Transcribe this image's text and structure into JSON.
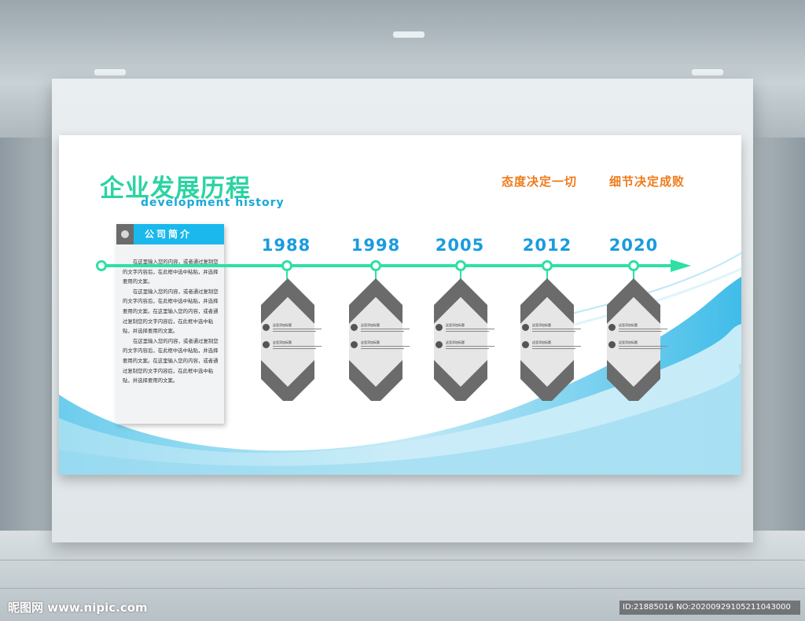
{
  "board": {
    "title_cn": "企业发展历程",
    "title_en": "development history",
    "slogans": [
      "态度决定一切",
      "细节决定成败"
    ]
  },
  "intro": {
    "heading": "公司简介",
    "paragraphs": [
      "在这里输入您的内容，或者通过复制您的文字内容后，在此框中选中粘贴，并选择要用的文案。",
      "在这里输入您的内容，或者通过复制您的文字内容后，在此框中选中粘贴，并选择要用的文案。在这里输入您的内容，或者通过复制您的文字内容后，在此框中选中粘贴，并选择要用的文案。",
      "在这里输入您的内容，或者通过复制您的文字内容后，在此框中选中粘贴，并选择要用的文案。在这里输入您的内容，或者通过复制您的文字内容后，在此框中选中粘贴，并选择要用的文案。"
    ]
  },
  "timeline": {
    "years": [
      "1988",
      "1998",
      "2005",
      "2012",
      "2020"
    ],
    "item_title": "这里添加标题"
  },
  "colors": {
    "accent_green": "#2ee0a5",
    "year_blue": "#1a9be0",
    "tab_blue": "#1ab8ec",
    "slogan_orange": "#f07a1a",
    "chevron_gray": "#6b6b6b"
  },
  "footer": {
    "watermark_left": "昵图网 www.nipic.com",
    "watermark_right": "ID:21885016 NO:20200929105211043000"
  }
}
